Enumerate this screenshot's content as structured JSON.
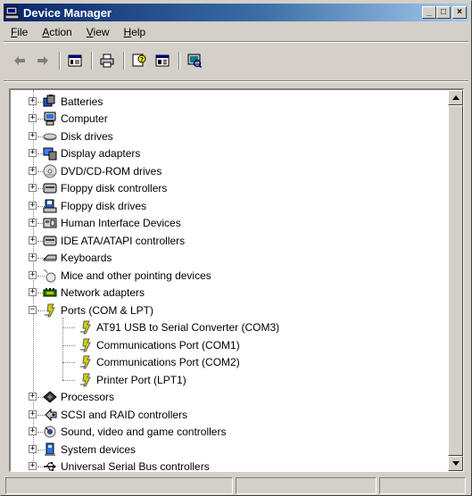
{
  "window": {
    "title": "Device Manager"
  },
  "title_buttons": {
    "minimize": "_",
    "maximize": "□",
    "close": "×"
  },
  "menu": [
    {
      "label": "File"
    },
    {
      "label": "Action"
    },
    {
      "label": "View"
    },
    {
      "label": "Help"
    }
  ],
  "toolbar": [
    {
      "name": "back-arrow-icon"
    },
    {
      "name": "forward-arrow-icon"
    },
    {
      "name": "properties-view-icon"
    },
    {
      "name": "print-icon"
    },
    {
      "name": "help-icon"
    },
    {
      "name": "show-hide-console-tree-icon"
    },
    {
      "name": "scan-hardware-icon"
    }
  ],
  "tree": {
    "items": [
      {
        "label": "Batteries",
        "icon": "battery-icon",
        "expanded": false
      },
      {
        "label": "Computer",
        "icon": "computer-icon",
        "expanded": false
      },
      {
        "label": "Disk drives",
        "icon": "disk-drive-icon",
        "expanded": false
      },
      {
        "label": "Display adapters",
        "icon": "display-adapter-icon",
        "expanded": false
      },
      {
        "label": "DVD/CD-ROM drives",
        "icon": "cdrom-icon",
        "expanded": false
      },
      {
        "label": "Floppy disk controllers",
        "icon": "controller-icon",
        "expanded": false
      },
      {
        "label": "Floppy disk drives",
        "icon": "floppy-drive-icon",
        "expanded": false
      },
      {
        "label": "Human Interface Devices",
        "icon": "hid-icon",
        "expanded": false
      },
      {
        "label": "IDE ATA/ATAPI controllers",
        "icon": "ide-controller-icon",
        "expanded": false
      },
      {
        "label": "Keyboards",
        "icon": "keyboard-icon",
        "expanded": false
      },
      {
        "label": "Mice and other pointing devices",
        "icon": "mouse-icon",
        "expanded": false
      },
      {
        "label": "Network adapters",
        "icon": "network-adapter-icon",
        "expanded": false
      },
      {
        "label": "Ports (COM & LPT)",
        "icon": "port-icon",
        "expanded": true,
        "children": [
          {
            "label": "AT91 USB to Serial Converter (COM3)",
            "icon": "port-icon"
          },
          {
            "label": "Communications Port (COM1)",
            "icon": "port-icon"
          },
          {
            "label": "Communications Port (COM2)",
            "icon": "port-icon"
          },
          {
            "label": "Printer Port (LPT1)",
            "icon": "port-icon"
          }
        ]
      },
      {
        "label": "Processors",
        "icon": "processor-icon",
        "expanded": false
      },
      {
        "label": "SCSI and RAID controllers",
        "icon": "scsi-icon",
        "expanded": false
      },
      {
        "label": "Sound, video and game controllers",
        "icon": "sound-icon",
        "expanded": false
      },
      {
        "label": "System devices",
        "icon": "system-device-icon",
        "expanded": false
      },
      {
        "label": "Universal Serial Bus controllers",
        "icon": "usb-icon",
        "expanded": false
      }
    ]
  },
  "colors": {
    "titlebar_start": "#0a246a",
    "titlebar_end": "#a6caf0",
    "chrome": "#d4d0c8"
  }
}
